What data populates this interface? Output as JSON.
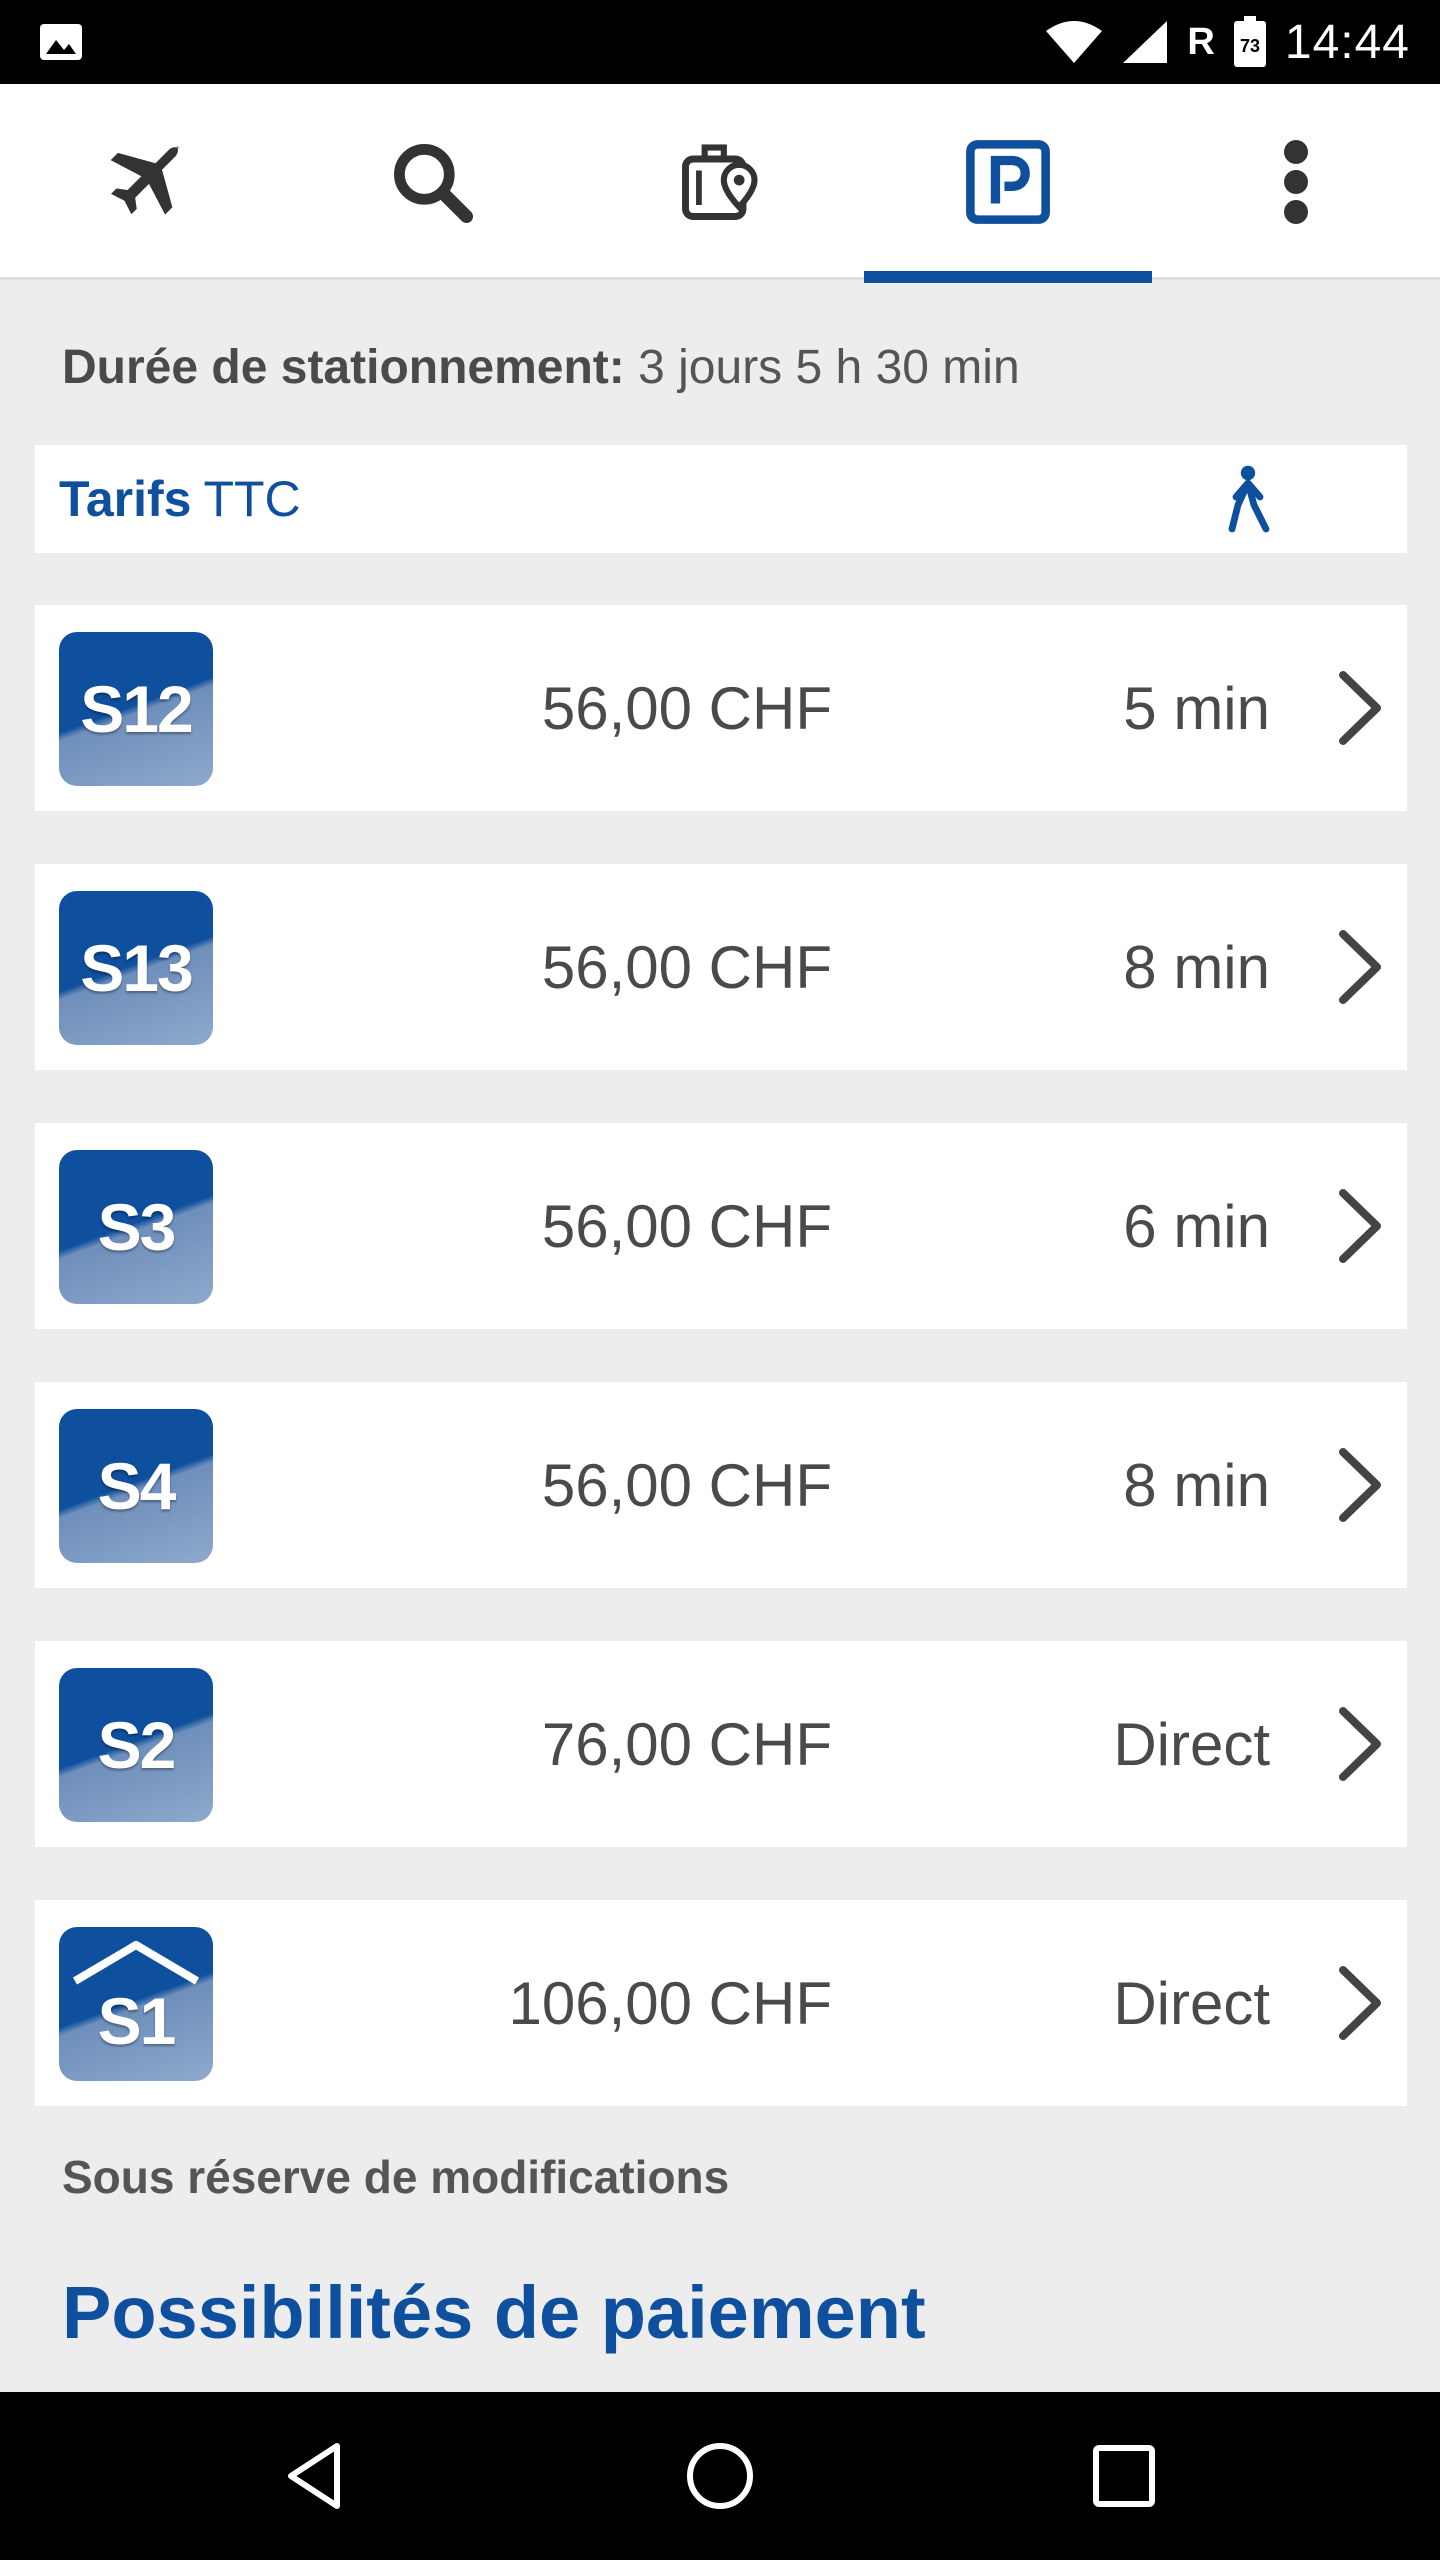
{
  "status_bar": {
    "time": "14:44",
    "roaming_indicator": "R",
    "battery_level": "73",
    "icons": [
      "gallery-icon",
      "wifi-icon",
      "cell-signal-icon",
      "battery-icon"
    ]
  },
  "top_nav": {
    "tabs": [
      {
        "name": "flights",
        "icon": "airplane-icon",
        "active": false
      },
      {
        "name": "search",
        "icon": "search-icon",
        "active": false
      },
      {
        "name": "luggage",
        "icon": "luggage-location-icon",
        "active": false
      },
      {
        "name": "parking",
        "icon": "parking-icon",
        "active": true
      },
      {
        "name": "more",
        "icon": "more-vert-icon",
        "active": false
      }
    ],
    "accent_color": "#0e4f9e"
  },
  "duration": {
    "label": "Durée de stationnement:",
    "value": "3 jours 5 h 30 min"
  },
  "tarifs": {
    "label_bold": "Tarifs",
    "label_light": "TTC",
    "walk_icon": "pedestrian-icon"
  },
  "parkings": [
    {
      "code": "S12",
      "price": "56,00 CHF",
      "walk": "5 min",
      "covered": false
    },
    {
      "code": "S13",
      "price": "56,00 CHF",
      "walk": "8 min",
      "covered": false
    },
    {
      "code": "S3",
      "price": "56,00 CHF",
      "walk": "6 min",
      "covered": false
    },
    {
      "code": "S4",
      "price": "56,00 CHF",
      "walk": "8 min",
      "covered": false
    },
    {
      "code": "S2",
      "price": "76,00 CHF",
      "walk": "Direct",
      "covered": false
    },
    {
      "code": "S1",
      "price": "106,00 CHF",
      "walk": "Direct",
      "covered": true
    }
  ],
  "note": "Sous réserve de modifications",
  "payment_title": "Possibilités de paiement",
  "bottom_nav": {
    "buttons": [
      "back-icon",
      "home-icon",
      "recents-icon"
    ]
  }
}
